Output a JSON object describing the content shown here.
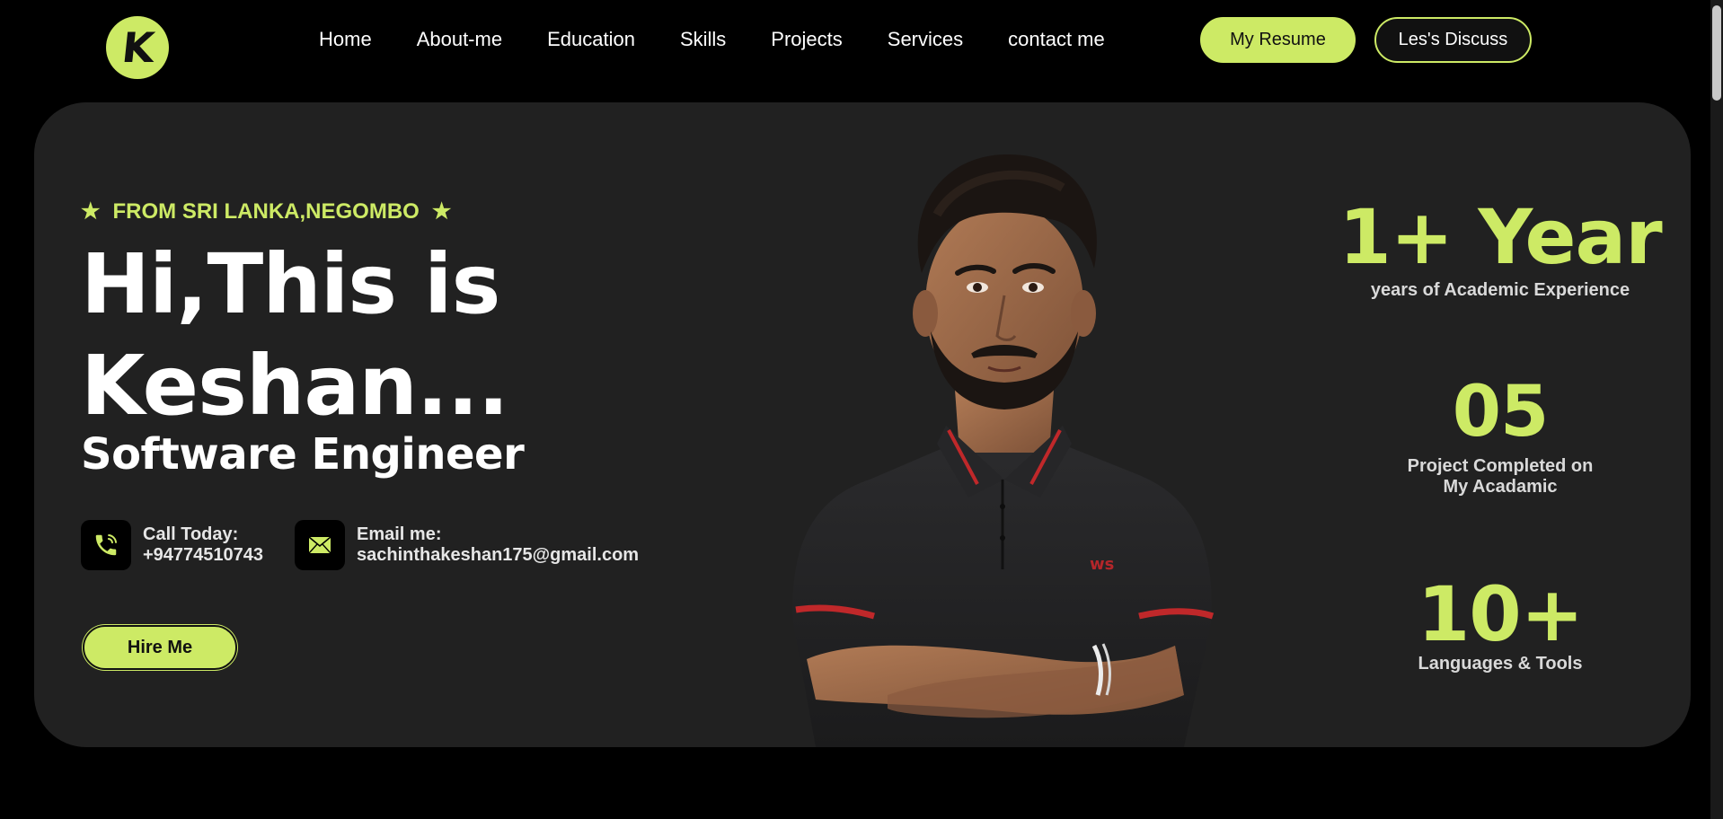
{
  "logo": {
    "letter": "K",
    "icon": "k-logo-icon"
  },
  "nav": {
    "items": [
      "Home",
      "About-me",
      "Education",
      "Skills",
      "Projects",
      "Services",
      "contact me"
    ]
  },
  "header": {
    "resume_label": "My Resume",
    "discuss_label": "Les's Discuss"
  },
  "hero": {
    "origin": "FROM SRI LANKA,NEGOMBO",
    "headline_line1": "Hi,This is",
    "headline_line2": "Keshan...",
    "role": "Software Engineer",
    "call": {
      "label": "Call Today:",
      "value": "+94774510743",
      "icon": "phone-icon"
    },
    "email": {
      "label": "Email me:",
      "value": "sachinthakeshan175@gmail.com",
      "icon": "mail-icon"
    },
    "hire_label": "Hire Me"
  },
  "stats": [
    {
      "value": "1+ Year",
      "label": "years of Academic Experience"
    },
    {
      "value": "05",
      "label": "Project Completed on My Acadamic"
    },
    {
      "value": "10+",
      "label": "Languages & Tools"
    }
  ],
  "colors": {
    "accent": "#cdea65",
    "card": "#212121",
    "background": "#000000"
  }
}
